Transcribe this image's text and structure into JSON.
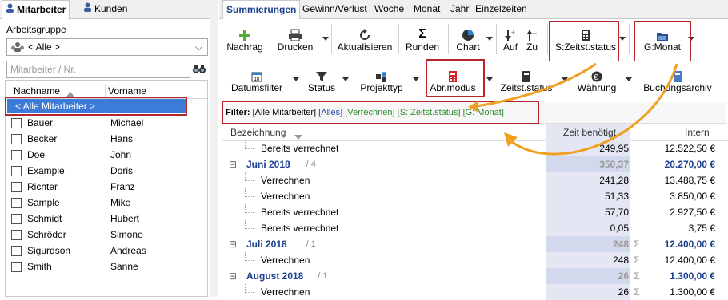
{
  "left": {
    "tabs": [
      {
        "label": "Mitarbeiter"
      },
      {
        "label": "Kunden"
      }
    ],
    "group_label": "Arbeitsgruppe",
    "group_value": "< Alle >",
    "search_placeholder": "Mitarbeiter / Nr.",
    "columns": [
      "Nachname",
      "Vorname"
    ],
    "all_row": "< Alle Mitarbeiter >",
    "rows": [
      {
        "last": "Bauer",
        "first": "Michael"
      },
      {
        "last": "Becker",
        "first": "Hans"
      },
      {
        "last": "Doe",
        "first": "John"
      },
      {
        "last": "Example",
        "first": "Doris"
      },
      {
        "last": "Richter",
        "first": "Franz"
      },
      {
        "last": "Sample",
        "first": "Mike"
      },
      {
        "last": "Schmidt",
        "first": "Hubert"
      },
      {
        "last": "Schröder",
        "first": "Simone"
      },
      {
        "last": "Sigurdson",
        "first": "Andreas"
      },
      {
        "last": "Smith",
        "first": "Sanne"
      }
    ]
  },
  "right": {
    "tabs": [
      "Summierungen",
      "Gewinn/Verlust",
      "Woche",
      "Monat",
      "Jahr",
      "Einzelzeiten"
    ],
    "toolbar1": {
      "nachrag": "Nachrag",
      "drucken": "Drucken",
      "aktualisieren": "Aktualisieren",
      "runden": "Runden",
      "chart": "Chart",
      "auf": "Auf",
      "zu": "Zu",
      "zeitst": "S:Zeitst.status",
      "monat": "G:Monat"
    },
    "toolbar2": {
      "datumsfilter": "Datumsfilter",
      "status": "Status",
      "projekttyp": "Projekttyp",
      "abrmodus": "Abr.modus",
      "zeitststatus": "Zeitst.status",
      "waehrung": "Währung",
      "buchungsarchiv": "Buchungsarchiv"
    },
    "filter": {
      "label": "Filter:",
      "p1": "[Alle Mitarbeiter]",
      "p2": "[Alles]",
      "p3": "[Verrechnen]",
      "p4": "[S: Zeitst.status]",
      "p5": "[G: Monat]"
    },
    "columns": {
      "bez": "Bezeichnung",
      "zeit": "Zeit benötigt",
      "intern": "Intern"
    },
    "rows": [
      {
        "label": "Bereits verrechnet",
        "zeit": "249,95",
        "intern": "12.522,50 €"
      },
      {
        "label": "Juni 2018",
        "count": "/ 4",
        "zeit": "350,37",
        "intern": "20.270,00 €"
      },
      {
        "label": "Verrechnen",
        "zeit": "241,28",
        "intern": "13.488,75 €"
      },
      {
        "label": "Verrechnen",
        "zeit": "51,33",
        "intern": "3.850,00 €"
      },
      {
        "label": "Bereits verrechnet",
        "zeit": "57,70",
        "intern": "2.927,50 €"
      },
      {
        "label": "Bereits verrechnet",
        "zeit": "0,05",
        "intern": "3,75 €"
      },
      {
        "label": "Juli 2018",
        "count": "/ 1",
        "zeit": "248",
        "intern": "12.400,00 €"
      },
      {
        "label": "Verrechnen",
        "zeit": "248",
        "intern": "12.400,00 €"
      },
      {
        "label": "August 2018",
        "count": "/ 1",
        "zeit": "26",
        "intern": "1.300,00 €"
      },
      {
        "label": "Verrechnen",
        "zeit": "26",
        "intern": "1.300,00 €"
      }
    ]
  },
  "colors": {
    "accent": "#1a3f8f",
    "highlight_box": "#b3262b",
    "arrow": "#f0a020",
    "filter_green": "#2e8b2e",
    "filter_blue": "#1a3fa8"
  }
}
